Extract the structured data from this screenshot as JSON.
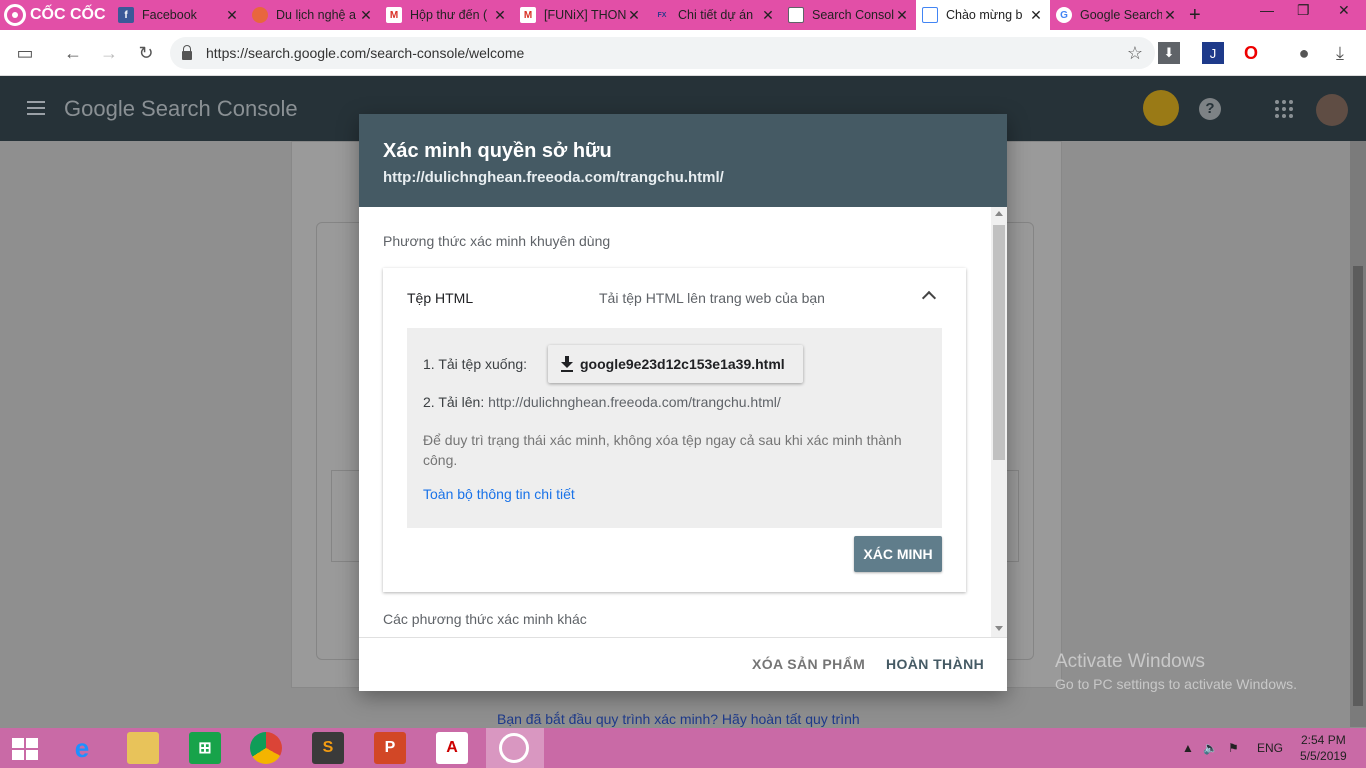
{
  "browser": {
    "brand": "CỐC CỐC",
    "tabs": [
      {
        "title": "Facebook",
        "icon": "facebook-icon",
        "color": "#3b5998"
      },
      {
        "title": "Du lịch nghệ a",
        "icon": "page-icon",
        "color": "#e8663d"
      },
      {
        "title": "Hộp thư đến (",
        "icon": "gmail-icon",
        "color": "#d93025"
      },
      {
        "title": "[FUNiX] THON",
        "icon": "gmail-icon",
        "color": "#d93025"
      },
      {
        "title": "Chi tiết dự án",
        "icon": "funix-icon",
        "color": "#2b3a8c"
      },
      {
        "title": "Search Consol",
        "icon": "search-console-icon",
        "color": "#5f6368"
      },
      {
        "title": "Chào mừng b",
        "icon": "search-console-icon",
        "color": "#5f6368"
      },
      {
        "title": "Google Search",
        "icon": "google-icon",
        "color": "#4285f4"
      }
    ],
    "new_tab": "+",
    "url": "https://search.google.com/search-console/welcome"
  },
  "header": {
    "title": "Google Search Console"
  },
  "background": {
    "resume_link": "Bạn đã bắt đầu quy trình xác minh? Hãy hoàn tất quy trình"
  },
  "dialog": {
    "title": "Xác minh quyền sở hữu",
    "subtitle": "http://dulichnghean.freeoda.com/trangchu.html/",
    "recommended_label": "Phương thức xác minh khuyên dùng",
    "method": {
      "name": "Tệp HTML",
      "description": "Tải tệp HTML lên trang web của bạn",
      "step1_label": "1. Tải tệp xuống:",
      "download_file": "google9e23d12c153e1a39.html",
      "step2_label": "2. Tải lên:",
      "step2_url": "http://dulichnghean.freeoda.com/trangchu.html/",
      "note": "Để duy trì trạng thái xác minh, không xóa tệp ngay cả sau khi xác minh thành công.",
      "details_link": "Toàn bộ thông tin chi tiết",
      "verify_button": "XÁC MINH"
    },
    "other_methods_label": "Các phương thức xác minh khác",
    "footer": {
      "delete_button": "XÓA SẢN PHẨM",
      "done_button": "HOÀN THÀNH"
    }
  },
  "watermark": {
    "line1": "Activate Windows",
    "line2": "Go to PC settings to activate Windows."
  },
  "taskbar": {
    "language": "ENG",
    "time": "2:54 PM",
    "date": "5/5/2019"
  },
  "colors": {
    "tab_strip": "#e24fa7",
    "header": "#263238",
    "dialog_header": "#455a64",
    "verify_button": "#607d8b",
    "link": "#1a73e8",
    "taskbar": "#c96aa6"
  }
}
